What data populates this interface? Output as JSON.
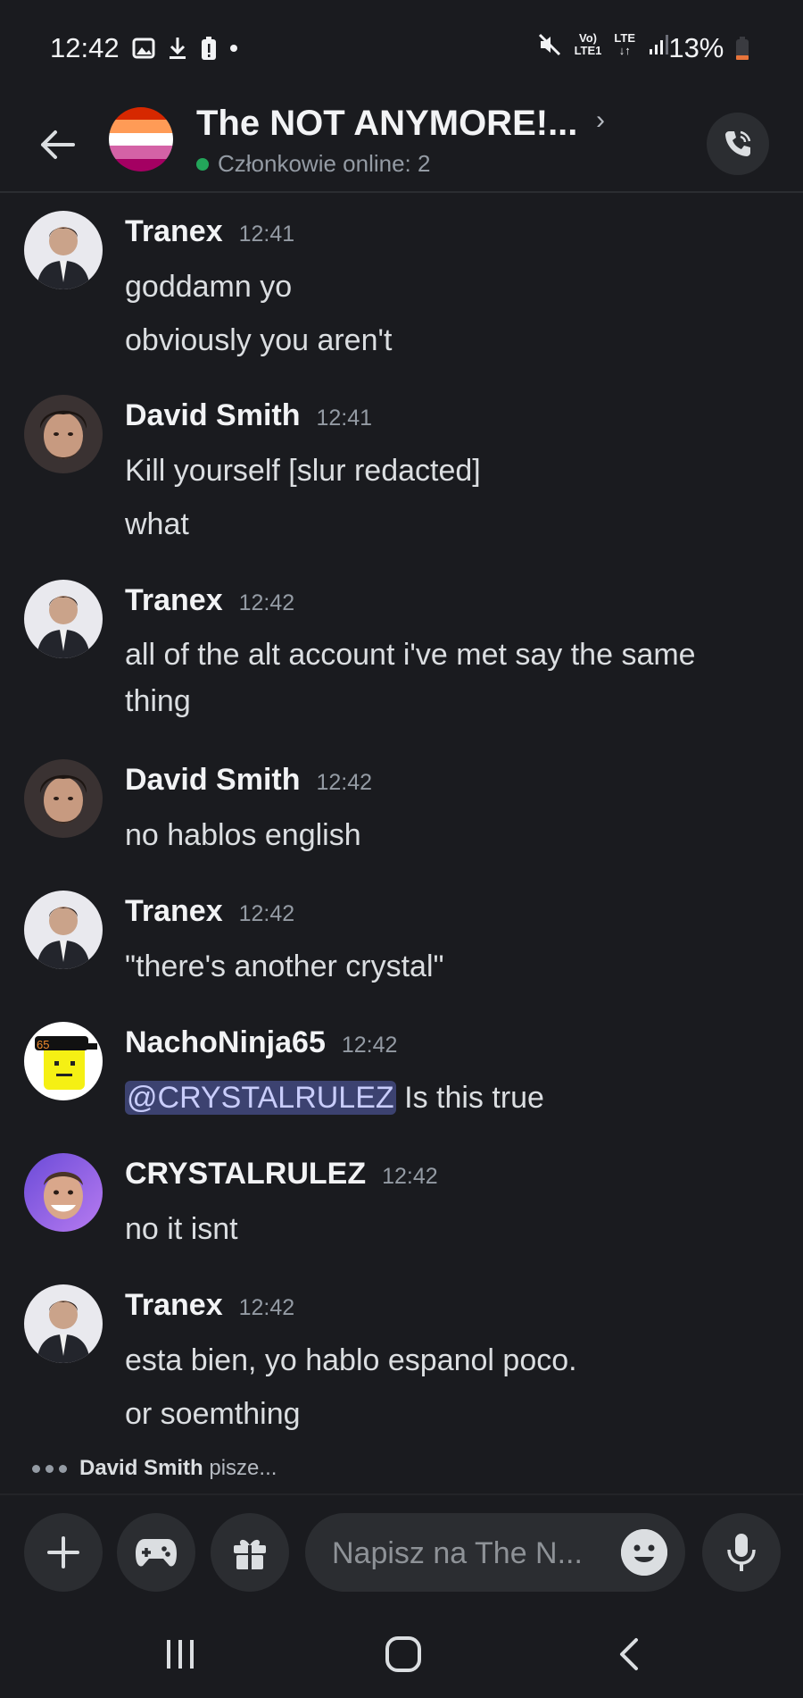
{
  "status_bar": {
    "time": "12:42",
    "battery": "13%",
    "network_top": "Vo)",
    "network_bottom": "LTE1",
    "network_type": "LTE"
  },
  "header": {
    "title": "The NOT ANYMORE!...",
    "subtitle": "Członkowie online: 2",
    "online_color": "#23a55a"
  },
  "messages": [
    {
      "author": "Tranex",
      "time": "12:41",
      "lines": [
        "goddamn yo",
        "obviously you aren't"
      ]
    },
    {
      "author": "David Smith",
      "time": "12:41",
      "lines": [
        "Kill yourself [slur redacted]",
        "what"
      ]
    },
    {
      "author": "Tranex",
      "time": "12:42",
      "lines": [
        "all of the alt account i've met say the same thing"
      ]
    },
    {
      "author": "David Smith",
      "time": "12:42",
      "lines": [
        "no hablos english"
      ]
    },
    {
      "author": "Tranex",
      "time": "12:42",
      "lines": [
        "\"there's another crystal\""
      ]
    },
    {
      "author": "NachoNinja65",
      "time": "12:42",
      "mention": "@CRYSTALRULEZ",
      "lines": [
        " Is this true"
      ],
      "avatar_text": "65"
    },
    {
      "author": "CRYSTALRULEZ",
      "time": "12:42",
      "lines": [
        "no it isnt"
      ]
    },
    {
      "author": "Tranex",
      "time": "12:42",
      "lines": [
        "esta bien, yo hablo espanol poco.",
        "or soemthing"
      ]
    }
  ],
  "typing": {
    "user": "David Smith",
    "suffix": " pisze..."
  },
  "composer": {
    "placeholder": "Napisz na The N..."
  },
  "colors": {
    "background": "#1a1b1f",
    "mention_bg": "#3c4270",
    "accent": "#5865f2"
  }
}
